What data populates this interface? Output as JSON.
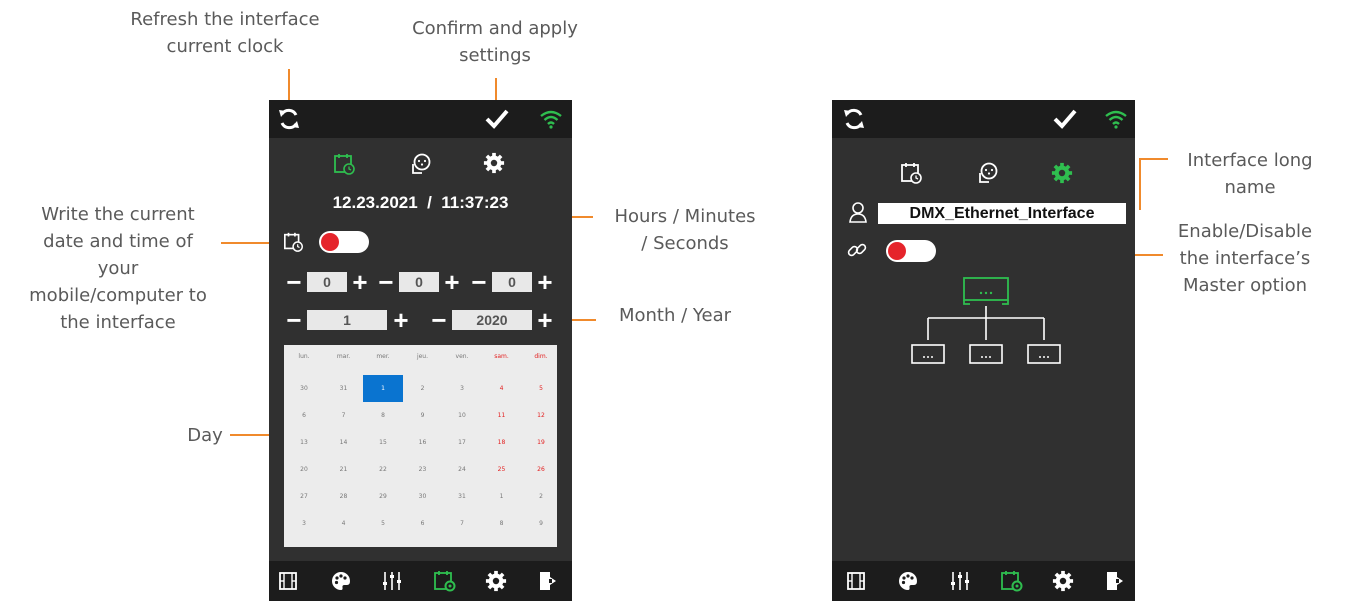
{
  "callouts": {
    "refresh": "Refresh the interface\ncurrent clock",
    "confirm": "Confirm and apply\nsettings",
    "write_time": "Write the current\ndate and time of\nyour\nmobile/computer to\nthe interface",
    "hms": "Hours / Minutes\n/ Seconds",
    "month_year": "Month / Year",
    "day": "Day",
    "long_name": "Interface long\nname",
    "master": "Enable/Disable\nthe interface’s\nMaster option"
  },
  "colors": {
    "accent_green": "#2fbe4f",
    "callout_orange": "#f08a2c",
    "toggle_red": "#e5242b",
    "phone_bg": "#303030"
  },
  "left_screen": {
    "datetime": "12.23.2021  /  11:37:23",
    "hours": "0",
    "minutes": "0",
    "seconds": "0",
    "month": "1",
    "year": "2020",
    "minus": "−",
    "plus": "+",
    "tabs": [
      "calendar-clock-icon",
      "dmx-connector-icon",
      "gear-icon"
    ],
    "active_tab": "calendar-clock-icon"
  },
  "calendar": {
    "weekdays": [
      "lun.",
      "mar.",
      "mer.",
      "jeu.",
      "ven.",
      "sam.",
      "dim."
    ],
    "weeks": [
      [
        "30",
        "31",
        "1",
        "2",
        "3",
        "4",
        "5"
      ],
      [
        "6",
        "7",
        "8",
        "9",
        "10",
        "11",
        "12"
      ],
      [
        "13",
        "14",
        "15",
        "16",
        "17",
        "18",
        "19"
      ],
      [
        "20",
        "21",
        "22",
        "23",
        "24",
        "25",
        "26"
      ],
      [
        "27",
        "28",
        "29",
        "30",
        "31",
        "1",
        "2"
      ],
      [
        "3",
        "4",
        "5",
        "6",
        "7",
        "8",
        "9"
      ]
    ],
    "selected": "1"
  },
  "right_screen": {
    "interface_name": "DMX_Ethernet_Interface",
    "active_tab": "gear-icon"
  },
  "bottom_nav": [
    "film-icon",
    "palette-icon",
    "sliders-icon",
    "calendar-gear-icon",
    "gear-icon",
    "exit-icon"
  ]
}
